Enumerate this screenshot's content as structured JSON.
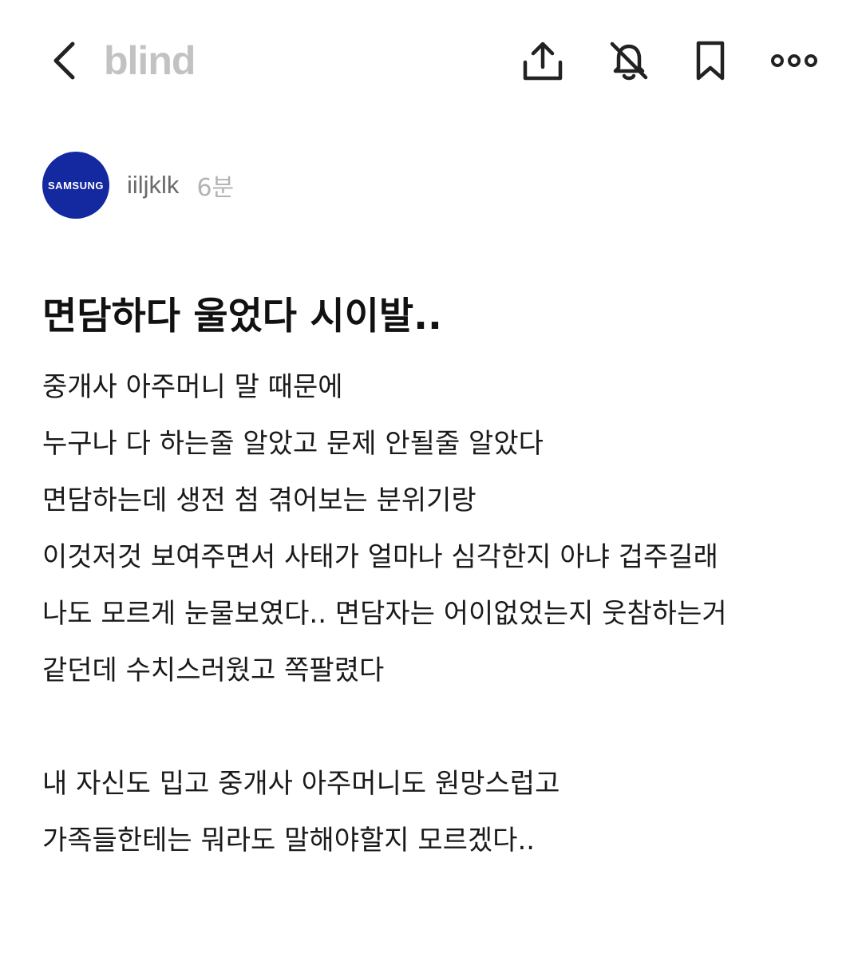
{
  "header": {
    "logo_text": "blind",
    "icons": {
      "back": "chevron-left-icon",
      "share": "share-icon",
      "notify": "bell-off-icon",
      "bookmark": "bookmark-icon",
      "more": "more-dots-icon"
    }
  },
  "author": {
    "avatar_text": "SAMSUNG",
    "avatar_color": "#1428a0",
    "name": "iiljklk",
    "time": "6분"
  },
  "post": {
    "title": "면담하다 울었다 시이발..",
    "lines": [
      "중개사 아주머니 말 때문에",
      "누구나 다 하는줄 알았고 문제 안될줄 알았다",
      "면담하는데 생전 첨 겪어보는 분위기랑",
      "이것저것 보여주면서 사태가 얼마나 심각한지 아냐 겁주길래",
      "나도 모르게 눈물보였다.. 면담자는 어이없었는지 웃참하는거",
      "같던데 수치스러웠고 쪽팔렸다",
      "",
      "내 자신도 밉고 중개사 아주머니도 원망스럽고",
      "가족들한테는 뭐라도 말해야할지 모르겠다.."
    ]
  }
}
